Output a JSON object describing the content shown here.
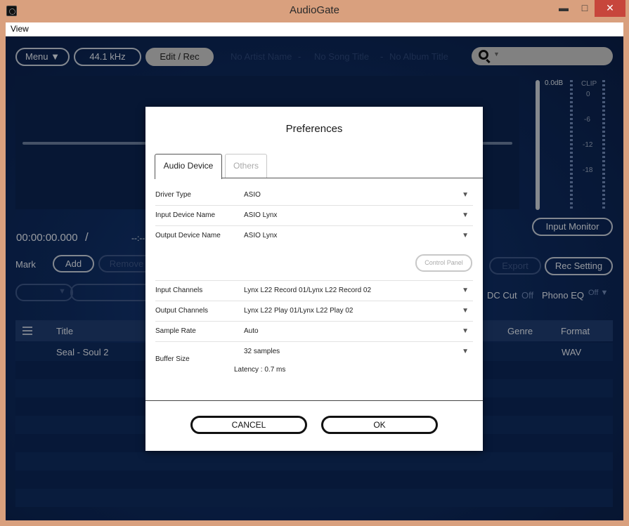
{
  "window": {
    "title": "AudioGate",
    "min_glyph": "▬",
    "max_glyph": "□",
    "close_glyph": "✕"
  },
  "menubar": {
    "view": "View"
  },
  "toolbar": {
    "menu_label": "Menu",
    "sample_rate": "44.1 kHz",
    "edit_rec_label": "Edit / Rec",
    "artist_placeholder": "No Artist Name",
    "song_placeholder": "No Song Title",
    "album_placeholder": "No Album Title",
    "separator": "-",
    "search_dropdown_glyph": "▼"
  },
  "meter": {
    "peak_label": "0.0dB",
    "clip_label": "CLIP",
    "scale": [
      "0",
      "-6",
      "-12",
      "-18"
    ]
  },
  "transport": {
    "time_current": "00:00:00.000",
    "time_separator": "/",
    "time_total": "--:--"
  },
  "mark": {
    "label": "Mark",
    "add": "Add",
    "remove": "Remove"
  },
  "right_controls": {
    "input_monitor": "Input Monitor",
    "export": "Export",
    "rec_setting": "Rec Setting",
    "dc_cut": "DC Cut",
    "dc_cut_state": "Off",
    "phono_eq": "Phono EQ",
    "phono_eq_state": "Off ▼"
  },
  "left_dropdown_glyph": "▼",
  "table": {
    "headers": {
      "title": "Title",
      "genre": "Genre",
      "format": "Format"
    },
    "rows": [
      {
        "title": "Seal - Soul 2",
        "format": "WAV"
      }
    ]
  },
  "dialog": {
    "title": "Preferences",
    "tabs": [
      "Audio Device",
      "Others"
    ],
    "rows": [
      {
        "label": "Driver Type",
        "value": "ASIO"
      },
      {
        "label": "Input Device Name",
        "value": "ASIO Lynx"
      },
      {
        "label": "Output Device Name",
        "value": "ASIO Lynx"
      },
      {
        "label": "Input Channels",
        "value": "Lynx L22 Record 01/Lynx L22 Record 02"
      },
      {
        "label": "Output Channels",
        "value": "Lynx L22 Play 01/Lynx L22 Play 02"
      },
      {
        "label": "Sample Rate",
        "value": "Auto"
      },
      {
        "label": "Buffer Size",
        "value": "32 samples"
      }
    ],
    "dropdown_glyph": "▼",
    "latency": "Latency : 0.7 ms",
    "control_panel": "Control Panel",
    "cancel": "CANCEL",
    "ok": "OK"
  }
}
